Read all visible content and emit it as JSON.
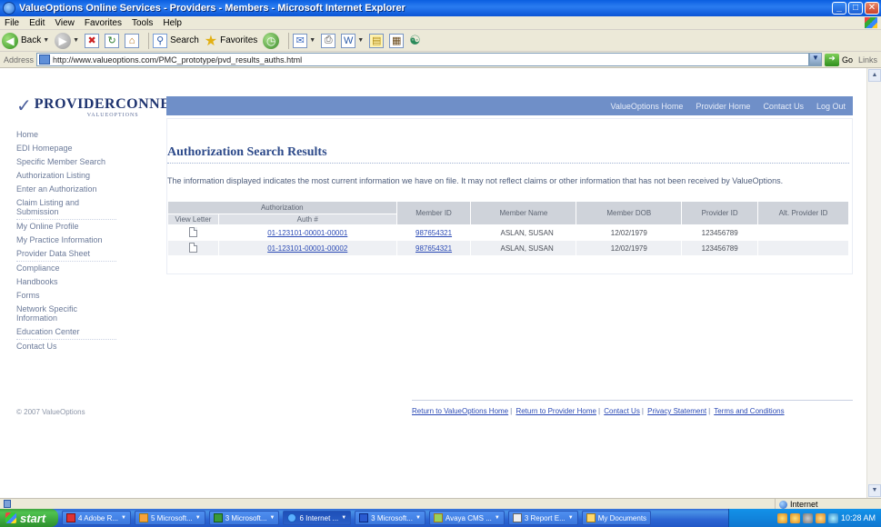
{
  "window": {
    "title": "ValueOptions Online Services - Providers - Members - Microsoft Internet Explorer",
    "minimize": "_",
    "maximize": "□",
    "close": "✕"
  },
  "menu": [
    "File",
    "Edit",
    "View",
    "Favorites",
    "Tools",
    "Help"
  ],
  "toolbar": {
    "back": "Back",
    "search": "Search",
    "favorites": "Favorites"
  },
  "address": {
    "label": "Address",
    "url": "http://www.valueoptions.com/PMC_prototype/pvd_results_auths.html",
    "go": "Go",
    "links": "Links"
  },
  "logo": {
    "brand": "PROVIDERCONNECT",
    "sub": "VALUEOPTIONS"
  },
  "topnav": [
    "ValueOptions Home",
    "Provider Home",
    "Contact Us",
    "Log Out"
  ],
  "sidebar": [
    "Home",
    "EDI Homepage",
    "Specific Member Search",
    "Authorization Listing",
    "Enter an Authorization",
    "Claim Listing and Submission",
    "My Online Profile",
    "My Practice Information",
    "Provider Data Sheet",
    "Compliance",
    "Handbooks",
    "Forms",
    "Network Specific Information",
    "Education Center",
    "Contact Us"
  ],
  "main": {
    "heading": "Authorization Search Results",
    "notice": "The information displayed indicates the most current information we have on file. It may not reflect claims or other information that has not been received by ValueOptions."
  },
  "table": {
    "group_header": "Authorization",
    "sub_headers": [
      "View Letter",
      "Auth #"
    ],
    "headers": [
      "Member ID",
      "Member Name",
      "Member DOB",
      "Provider ID",
      "Alt. Provider ID"
    ],
    "rows": [
      {
        "auth": "01-123101-00001-00001",
        "member_id": "987654321",
        "name": "ASLAN, SUSAN",
        "dob": "12/02/1979",
        "provider_id": "123456789",
        "alt_provider_id": ""
      },
      {
        "auth": "01-123101-00001-00002",
        "member_id": "987654321",
        "name": "ASLAN, SUSAN",
        "dob": "12/02/1979",
        "provider_id": "123456789",
        "alt_provider_id": ""
      }
    ]
  },
  "copyright": "© 2007 ValueOptions",
  "footer_links": [
    "Return to ValueOptions Home",
    "Return to Provider Home",
    "Contact Us",
    "Privacy Statement",
    "Terms and Conditions"
  ],
  "status": {
    "zone": "Internet"
  },
  "taskbar": {
    "start": "start",
    "tasks": [
      "4 Adobe R...",
      "5 Microsoft...",
      "3 Microsoft...",
      "6 Internet ...",
      "3 Microsoft...",
      "Avaya CMS ...",
      "3 Report E...",
      "My Documents"
    ],
    "clock": "10:28 AM"
  }
}
